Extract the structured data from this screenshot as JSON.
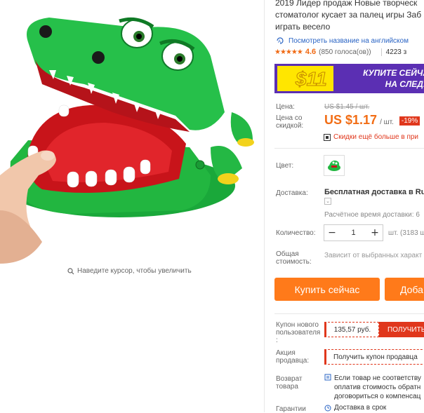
{
  "product": {
    "title_lines": [
      "2019 Лидер продаж Новые творческ",
      "стоматолог кусает за палец игры Заб",
      "играть весело"
    ],
    "translate_link": "Посмотреть название на английском",
    "rating": "4.6",
    "votes": "(850 голоса(ов))",
    "orders": "4223 з",
    "zoom_hint": "Наведите курсор, чтобы увеличить"
  },
  "banner": {
    "amount": "$11",
    "text_line1": "КУПИТЕ СЕЙЧА",
    "text_line2": "НА СЛЕДУ"
  },
  "pricing": {
    "price_label": "Цена:",
    "old_price": "US $1.45 / шт.",
    "sale_label_line1": "Цена со",
    "sale_label_line2": "скидкой:",
    "sale_price": "US $1.17",
    "unit": "/ шт.",
    "discount": "-19%",
    "app_discount": "Скидки ещё больше в при"
  },
  "options": {
    "color_label": "Цвет:",
    "shipping_label": "Доставка:",
    "shipping_value": "Бесплатная доставка в Russ",
    "shipping_eta": "Расчётное время доставки: 6",
    "quantity_label": "Количество:",
    "quantity_value": "1",
    "quantity_available": "шт. (3183 ш",
    "total_label_line1": "Общая",
    "total_label_line2": "стоимость:",
    "total_value": "Зависит от выбранных характ"
  },
  "actions": {
    "buy_now": "Купить сейчас",
    "add_to_cart": "Доба"
  },
  "promos": {
    "coupon_label_lines": [
      "Купон нового",
      "пользователя",
      ":"
    ],
    "coupon_value": "135,57 руб.",
    "coupon_button": "ПОЛУЧИТЬ",
    "seller_label_line1": "Акция",
    "seller_label_line2": "продавца:",
    "seller_button": "Получить купон продавца",
    "return_label_line1": "Возврат",
    "return_label_line2": "товара",
    "return_text_lines": [
      "Если товар не соответству",
      "оплатив стоимость обратн",
      "договориться о компенсац"
    ],
    "guarantee_label": "Гарантии",
    "guarantee_text": "Доставка в срок"
  },
  "colors": {
    "accent_orange": "#ff7a1a",
    "price_orange": "#f26d15",
    "discount_red": "#e0371c",
    "link_blue": "#2a64c4",
    "banner_purple": "#5b2fb3",
    "banner_yellow": "#ffe600"
  }
}
